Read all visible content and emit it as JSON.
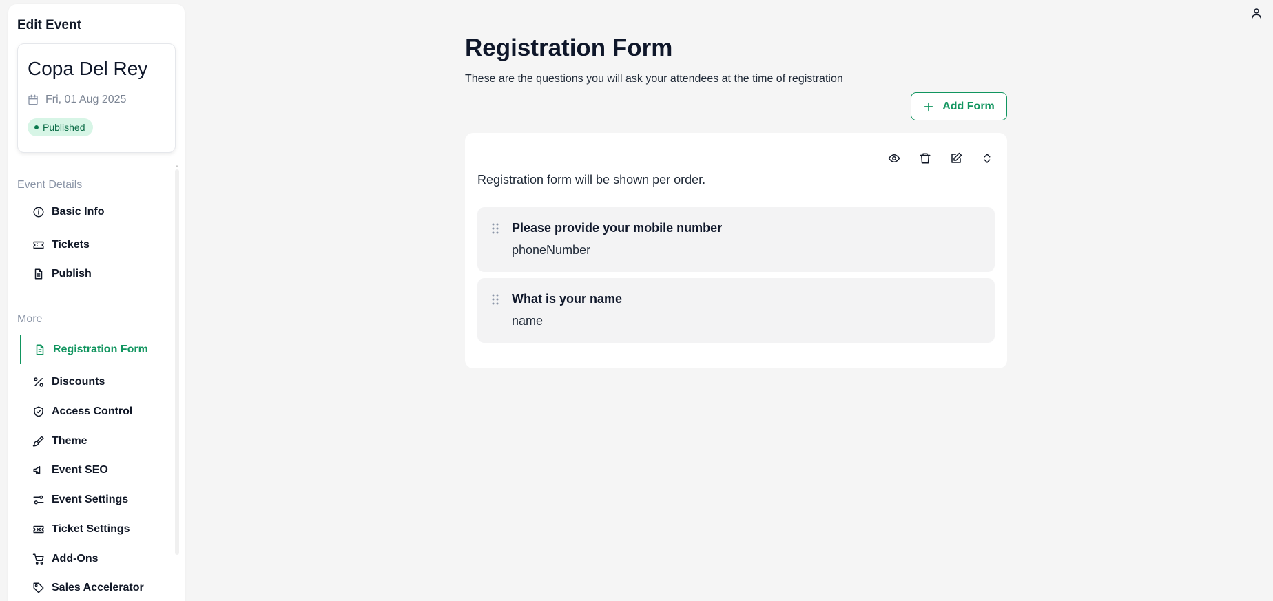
{
  "sidebar": {
    "title": "Edit Event",
    "event": {
      "name": "Copa Del Rey",
      "date": "Fri, 01 Aug 2025",
      "status": "Published"
    },
    "sections": [
      {
        "label": "Event Details"
      },
      {
        "label": "More"
      }
    ],
    "items": [
      {
        "label": "Basic Info",
        "icon": "info-icon"
      },
      {
        "label": "Tickets",
        "icon": "ticket-icon"
      },
      {
        "label": "Publish",
        "icon": "document-icon"
      },
      {
        "label": "Registration Form",
        "icon": "form-icon",
        "active": true
      },
      {
        "label": "Discounts",
        "icon": "percent-icon"
      },
      {
        "label": "Access Control",
        "icon": "shield-icon"
      },
      {
        "label": "Theme",
        "icon": "brush-icon"
      },
      {
        "label": "Event SEO",
        "icon": "megaphone-icon"
      },
      {
        "label": "Event Settings",
        "icon": "sliders-icon"
      },
      {
        "label": "Ticket Settings",
        "icon": "ticket-settings-icon"
      },
      {
        "label": "Add-Ons",
        "icon": "cart-icon"
      },
      {
        "label": "Sales Accelerator",
        "icon": "tag-icon"
      }
    ]
  },
  "header": {
    "user_icon": "user-icon"
  },
  "main": {
    "title": "Registration Form",
    "subtitle": "These are the questions you will ask your attendees at the time of registration",
    "add_button_label": "Add Form",
    "form": {
      "description": "Registration form will be shown per order.",
      "actions": [
        "eye-icon",
        "trash-icon",
        "edit-icon",
        "expand-icon"
      ],
      "questions": [
        {
          "title": "Please provide your mobile number",
          "key": "phoneNumber"
        },
        {
          "title": "What is your name",
          "key": "name"
        }
      ]
    }
  },
  "colors": {
    "accent": "#11955f",
    "badge_bg": "#d7f5e6",
    "page_bg": "#f5f5f5"
  }
}
